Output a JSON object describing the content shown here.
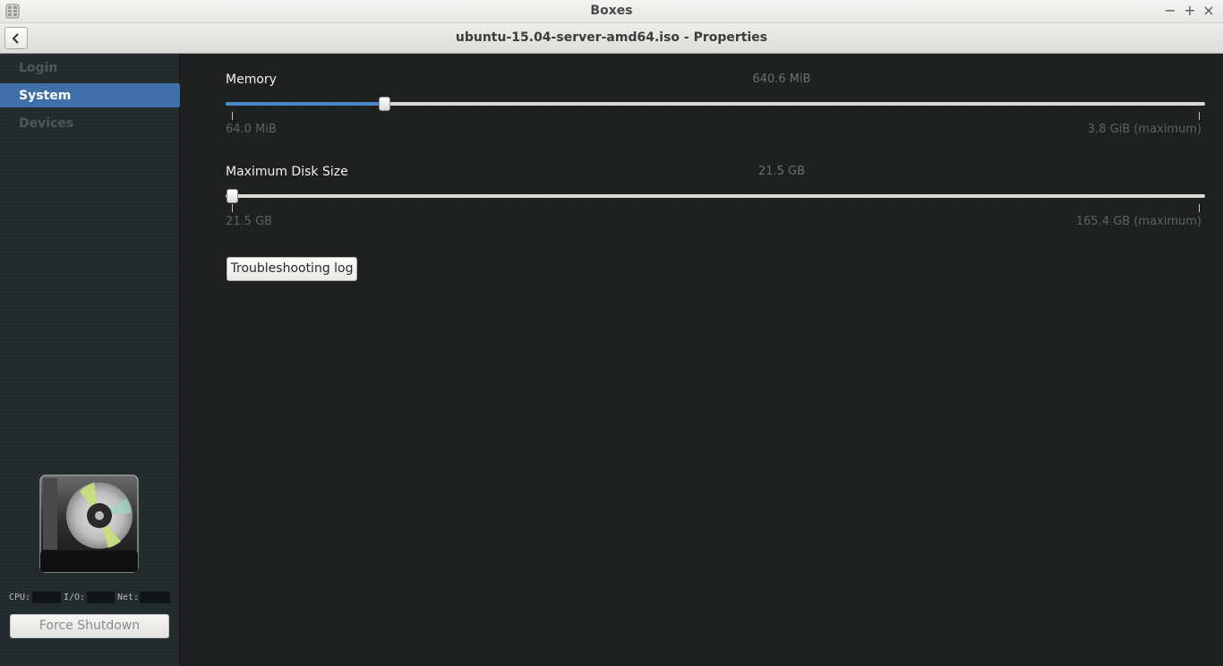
{
  "window": {
    "title": "Boxes"
  },
  "header": {
    "subtitle": "ubuntu-15.04-server-amd64.iso - Properties"
  },
  "sidebar": {
    "items": [
      {
        "label": "Login",
        "active": false
      },
      {
        "label": "System",
        "active": true
      },
      {
        "label": "Devices",
        "active": false
      }
    ],
    "stats": {
      "cpu": "CPU:",
      "io": "I/O:",
      "net": "Net:"
    },
    "force_shutdown": "Force Shutdown"
  },
  "memory": {
    "label": "Memory",
    "value": "640.6 MiB",
    "min": "64.0 MiB",
    "max": "3.8 GiB (maximum)",
    "level": 0.157
  },
  "disk": {
    "label": "Maximum Disk Size",
    "value": "21.5 GB",
    "min": "21.5 GB",
    "max": "165.4 GB (maximum)",
    "level": 0.0
  },
  "troubleshooting_button": "Troubleshooting log",
  "colors": {
    "accent": "#4a87c6",
    "sidebar_active": "#3f6fa8"
  }
}
